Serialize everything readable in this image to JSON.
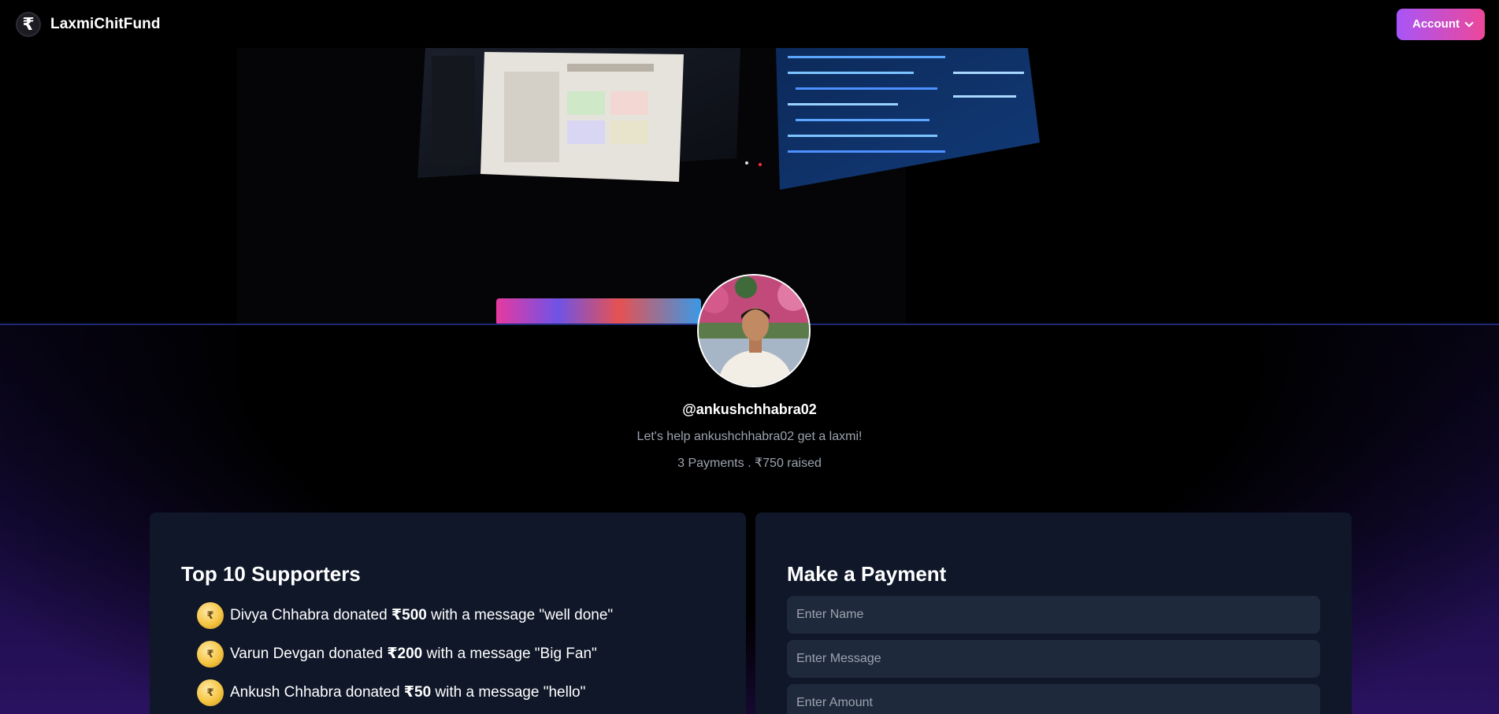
{
  "navbar": {
    "logo_glyph": "₹",
    "brand": "LaxmiChitFund",
    "account_label": "Account",
    "account_icon": "chevron-down-icon"
  },
  "profile": {
    "username": "@ankushchhabra02",
    "tagline": "Let's help ankushchhabra02 get a laxmi!",
    "stats": "3 Payments . ₹750 raised"
  },
  "supporters": {
    "title": "Top 10 Supporters",
    "items": [
      {
        "name": "Divya Chhabra",
        "pre": " donated ",
        "amount": "₹500",
        "post": " with a message \"well done\""
      },
      {
        "name": "Varun Devgan",
        "pre": " donated ",
        "amount": "₹200",
        "post": " with a message \"Big Fan\""
      },
      {
        "name": "Ankush Chhabra",
        "pre": " donated ",
        "amount": "₹50",
        "post": " with a message \"hello\""
      }
    ]
  },
  "payment": {
    "title": "Make a Payment",
    "name_placeholder": "Enter Name",
    "message_placeholder": "Enter Message",
    "amount_placeholder": "Enter Amount"
  },
  "colors": {
    "accent_from": "#a855f7",
    "accent_to": "#ec4899",
    "panel_bg": "#0f1729",
    "input_bg": "#1e293b"
  }
}
